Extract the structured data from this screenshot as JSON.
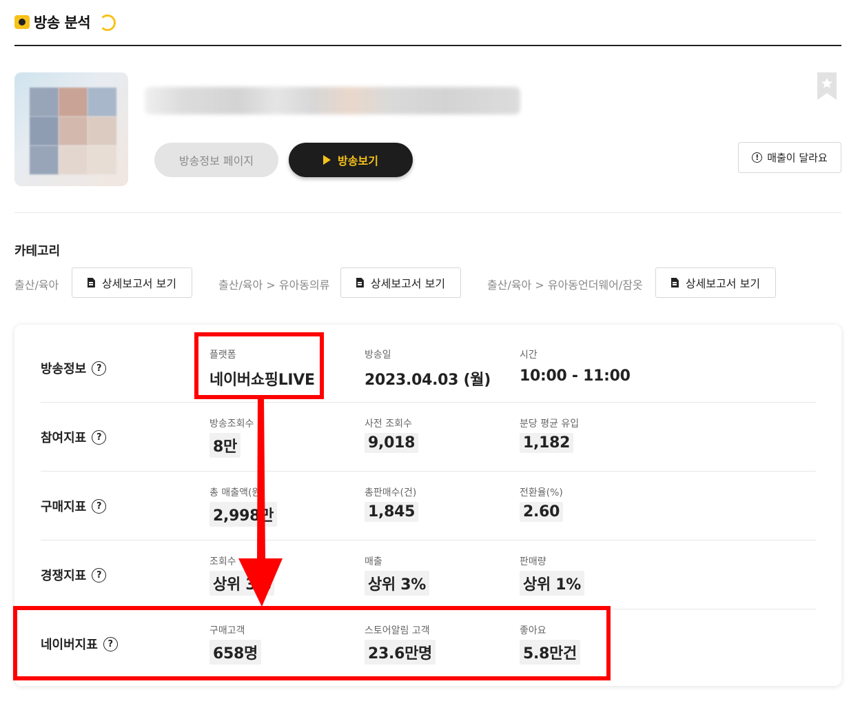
{
  "header": {
    "title": "방송 분석"
  },
  "product": {
    "buttons": {
      "info": "방송정보 페이지",
      "watch": "방송보기",
      "sales_report": "매출이 달라요"
    }
  },
  "category": {
    "title": "카테고리",
    "items": [
      {
        "label": "출산/육아",
        "button": "상세보고서 보기"
      },
      {
        "label": "출산/육아 > 유아동의류",
        "button": "상세보고서 보기"
      },
      {
        "label": "출산/육아 > 유아동언더웨어/잠옷",
        "button": "상세보고서 보기"
      }
    ]
  },
  "stats": [
    {
      "label": "방송정보",
      "metrics": [
        {
          "name": "플랫폼",
          "value": "네이버쇼핑LIVE"
        },
        {
          "name": "방송일",
          "value": "2023.04.03 (월)"
        },
        {
          "name": "시간",
          "value": "10:00 - 11:00"
        }
      ]
    },
    {
      "label": "참여지표",
      "metrics": [
        {
          "name": "방송조회수",
          "value": "8만"
        },
        {
          "name": "사전 조회수",
          "value": "9,018"
        },
        {
          "name": "분당 평균 유입",
          "value": "1,182"
        }
      ]
    },
    {
      "label": "구매지표",
      "metrics": [
        {
          "name": "총 매출액(원)",
          "value": "2,998만"
        },
        {
          "name": "총판매수(건)",
          "value": "1,845"
        },
        {
          "name": "전환율(%)",
          "value": "2.60"
        }
      ]
    },
    {
      "label": "경쟁지표",
      "metrics": [
        {
          "name": "조회수",
          "value": "상위 3%"
        },
        {
          "name": "매출",
          "value": "상위 3%"
        },
        {
          "name": "판매량",
          "value": "상위 1%"
        }
      ]
    },
    {
      "label": "네이버지표",
      "metrics": [
        {
          "name": "구매고객",
          "value": "658명"
        },
        {
          "name": "스토어알림 고객",
          "value": "23.6만명"
        },
        {
          "name": "좋아요",
          "value": "5.8만건"
        }
      ]
    }
  ],
  "icons": {
    "help": "?",
    "alert": "!"
  },
  "colors": {
    "accent": "#f7c21a",
    "annotation": "#ff0000",
    "dark_button": "#1d1d1d"
  }
}
